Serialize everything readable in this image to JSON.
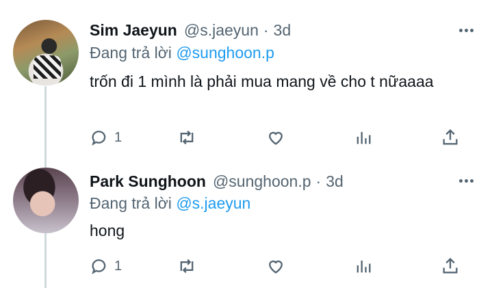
{
  "tweets": [
    {
      "name": "Sim Jaeyun",
      "handle": "@s.jaeyun",
      "separator": "·",
      "time": "3d",
      "reply_prefix": "Đang trả lời",
      "reply_to": "@sunghoon.p",
      "text": "trốn đi 1 mình là phải mua mang về cho t nữaaaa",
      "reply_count": "1"
    },
    {
      "name": "Park Sunghoon",
      "handle": "@sunghoon.p",
      "separator": "·",
      "time": "3d",
      "reply_prefix": "Đang trả lời",
      "reply_to": "@s.jaeyun",
      "text": "hong",
      "reply_count": "1"
    }
  ],
  "icons": {
    "more": "more-horizontal-icon",
    "reply": "reply-bubble-icon",
    "retweet": "retweet-icon",
    "like": "heart-icon",
    "stats": "bar-chart-icon",
    "share": "share-upload-icon"
  },
  "colors": {
    "accent": "#1d9bf0",
    "secondary_text": "#536471",
    "thread_line": "#cfd9de"
  }
}
